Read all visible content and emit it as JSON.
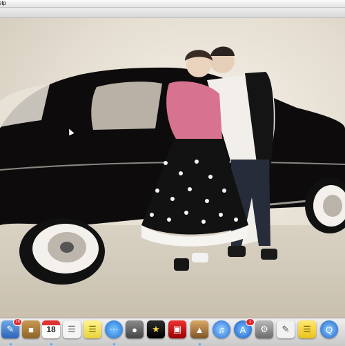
{
  "menubar": {
    "help_label": "elp"
  },
  "dock": {
    "items": [
      {
        "name": "preview-icon",
        "badge": "16"
      },
      {
        "name": "address-book-icon",
        "badge": ""
      },
      {
        "name": "calendar-icon",
        "badge": "",
        "date": "18"
      },
      {
        "name": "textedit-icon",
        "badge": ""
      },
      {
        "name": "stickies-icon",
        "badge": ""
      },
      {
        "name": "ichat-icon",
        "badge": ""
      },
      {
        "name": "video-camera-icon",
        "badge": ""
      },
      {
        "name": "imovie-star-icon",
        "badge": ""
      },
      {
        "name": "photo-booth-icon",
        "badge": ""
      },
      {
        "name": "iphoto-icon",
        "badge": ""
      },
      {
        "name": "itunes-icon",
        "badge": ""
      },
      {
        "name": "app-store-icon",
        "badge": "1"
      },
      {
        "name": "system-preferences-icon",
        "badge": ""
      },
      {
        "name": "script-editor-icon",
        "badge": ""
      },
      {
        "name": "notes-icon",
        "badge": ""
      },
      {
        "name": "quicktime-icon",
        "badge": ""
      }
    ]
  }
}
